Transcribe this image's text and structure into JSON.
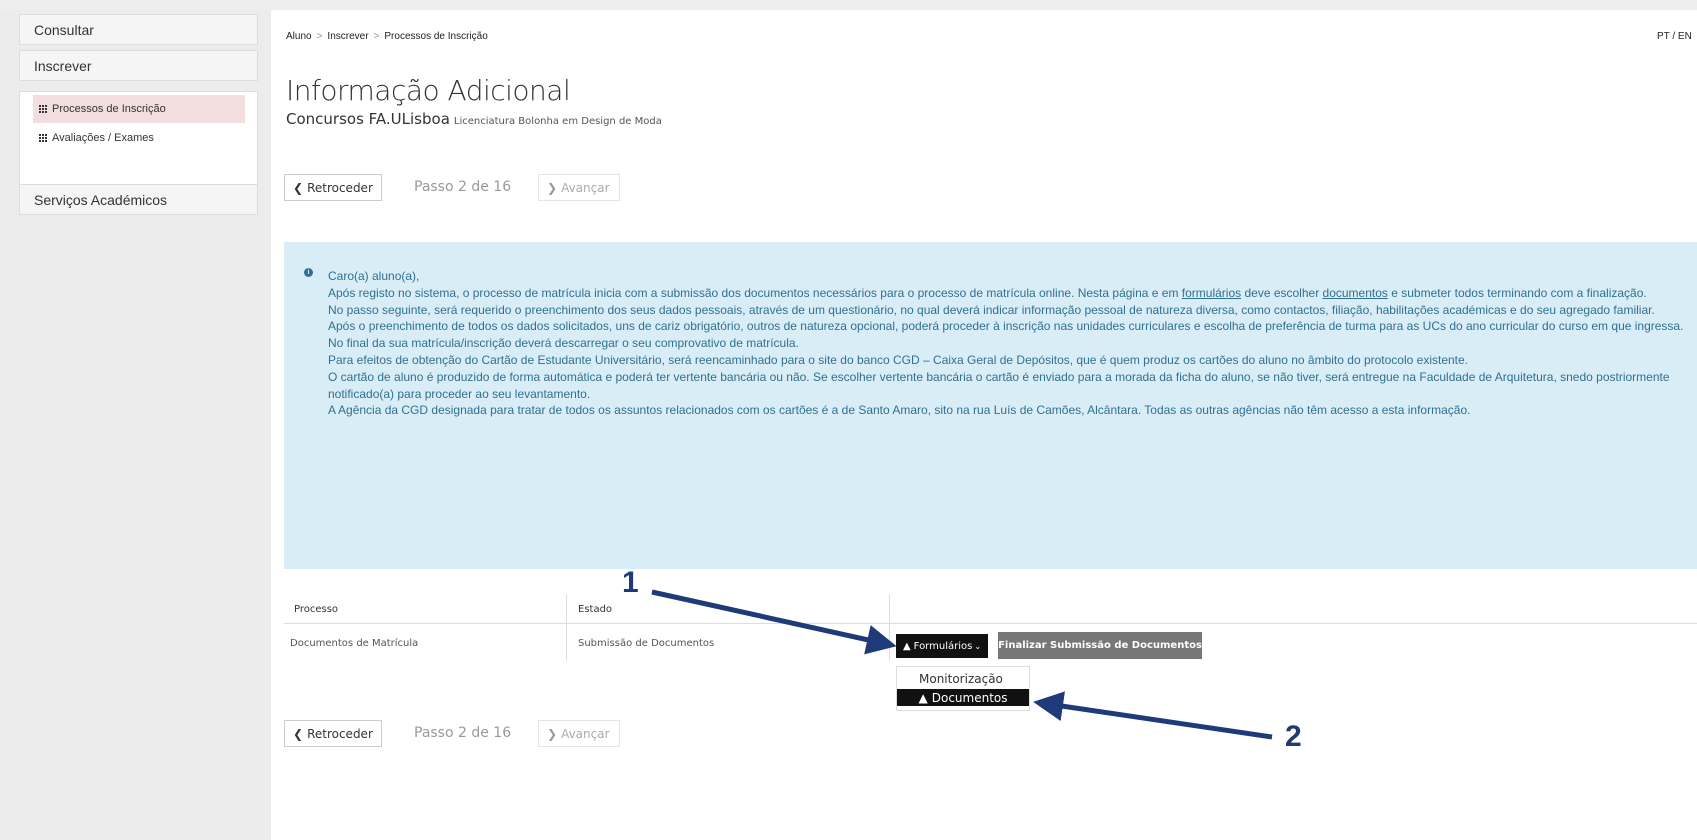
{
  "sidebar": {
    "consultar": "Consultar",
    "inscrever": "Inscrever",
    "items": [
      {
        "label": "Processos de Inscrição"
      },
      {
        "label": "Avaliações / Exames"
      }
    ],
    "servicos": "Serviços Académicos"
  },
  "breadcrumb": [
    "Aluno",
    "Inscrever",
    "Processos de Inscrição"
  ],
  "lang": "PT / EN",
  "title": "Informação Adicional",
  "subtitle": "Concursos FA.ULisboa",
  "subtitle_small": "Licenciatura Bolonha em Design de Moda",
  "nav": {
    "back": "Retroceder",
    "step": "Passo 2 de 16",
    "next": "Avançar"
  },
  "info": {
    "greeting": "Caro(a) aluno(a),",
    "p1a": "Após registo no sistema, o processo de matrícula inicia com a submissão dos documentos necessários para o processo de matrícula online. Nesta página e em ",
    "link1": "formulários",
    "p1b": " deve escolher ",
    "link2": "documentos",
    "p1c": " e submeter todos terminando com a finalização.",
    "p2": "No passo seguinte, será requerido o preenchimento dos seus dados pessoais, através de um questionário, no qual deverá indicar informação pessoal de natureza diversa, como contactos, filiação, habilitações académicas e do seu agregado familiar.",
    "p3": "Após o preenchimento de todos os dados solicitados, uns de cariz obrigatório, outros de natureza opcional, poderá proceder à inscrição nas unidades curriculares e escolha de preferência de turma para as UCs do ano curricular do curso em que ingressa.",
    "p4": "No final da sua matrícula/inscrição deverá descarregar o seu comprovativo de matrícula.",
    "p5": "Para efeitos de obtenção do Cartão de Estudante Universitário, será reencaminhado para o site do banco CGD – Caixa Geral de Depósitos, que é quem produz os cartões do aluno no âmbito do protocolo existente.",
    "p6": "O cartão de aluno é produzido de forma automática e poderá ter vertente bancária ou não. Se escolher vertente bancária o cartão é enviado para a morada da ficha do aluno, se não tiver, será entregue na Faculdade de Arquitetura, snedo postriormente notificado(a) para proceder ao seu levantamento.",
    "p7": "A Agência da CGD designada para tratar de todos os assuntos relacionados com os cartões é a de Santo Amaro, sito na rua Luís de Camões, Alcântara. Todas as outras agências não têm acesso a esta informação."
  },
  "table": {
    "headers": [
      "Processo",
      "Estado"
    ],
    "row": {
      "processo": "Documentos de Matrícula",
      "estado": "Submissão de Documentos"
    }
  },
  "actions": {
    "formularios": "Formulários",
    "finalizar": "Finalizar Submissão de Documentos"
  },
  "dropdown": {
    "monitorizacao": "Monitorização",
    "documentos": "Documentos"
  },
  "annotations": {
    "one": "1",
    "two": "2",
    "color": "#1f3a78"
  }
}
